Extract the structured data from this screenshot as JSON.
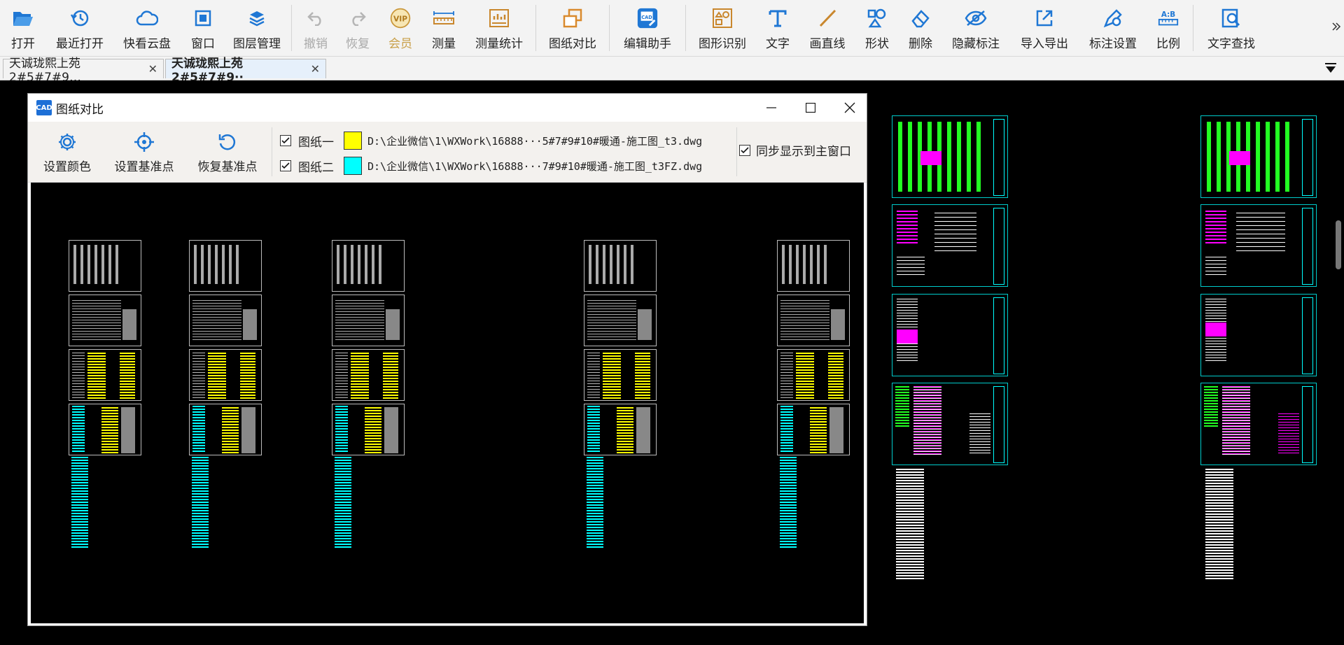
{
  "toolbar": {
    "items": [
      {
        "label": "打开",
        "icon": "folder-open-icon"
      },
      {
        "label": "最近打开",
        "icon": "history-icon"
      },
      {
        "label": "快看云盘",
        "icon": "cloud-icon"
      },
      {
        "label": "窗口",
        "icon": "window-icon"
      },
      {
        "label": "图层管理",
        "icon": "layers-icon"
      },
      {
        "label": "撤销",
        "icon": "undo-icon"
      },
      {
        "label": "恢复",
        "icon": "redo-icon"
      },
      {
        "label": "会员",
        "icon": "vip-icon"
      },
      {
        "label": "测量",
        "icon": "ruler-icon"
      },
      {
        "label": "测量统计",
        "icon": "measure-stats-icon"
      },
      {
        "label": "图纸对比",
        "icon": "compare-icon"
      },
      {
        "label": "编辑助手",
        "icon": "cad-edit-icon"
      },
      {
        "label": "图形识别",
        "icon": "shape-recognize-icon"
      },
      {
        "label": "文字",
        "icon": "text-icon"
      },
      {
        "label": "画直线",
        "icon": "line-icon"
      },
      {
        "label": "形状",
        "icon": "shapes-icon"
      },
      {
        "label": "删除",
        "icon": "eraser-icon"
      },
      {
        "label": "隐藏标注",
        "icon": "eye-off-icon"
      },
      {
        "label": "导入导出",
        "icon": "import-export-icon"
      },
      {
        "label": "标注设置",
        "icon": "annotation-settings-icon"
      },
      {
        "label": "比例",
        "icon": "scale-icon"
      },
      {
        "label": "文字查找",
        "icon": "text-search-icon"
      }
    ]
  },
  "tabs": [
    {
      "label": "天诚珑熙上苑2#5#7#9…",
      "active": false
    },
    {
      "label": "天诚珑熙上苑2#5#7#9··",
      "active": true
    }
  ],
  "dialog": {
    "title": "图纸对比",
    "app_icon_text": "CAD",
    "buttons": {
      "set_color": "设置颜色",
      "set_base_point": "设置基准点",
      "restore_base_point": "恢复基准点"
    },
    "drawing1": {
      "label": "图纸一",
      "color": "#ffff00",
      "path": "D:\\企业微信\\1\\WXWork\\16888···5#7#9#10#暖通-施工图_t3.dwg"
    },
    "drawing2": {
      "label": "图纸二",
      "color": "#00ffff",
      "path": "D:\\企业微信\\1\\WXWork\\16888···7#9#10#暖通-施工图_t3FZ.dwg"
    },
    "sync_label": "同步显示到主窗口"
  }
}
